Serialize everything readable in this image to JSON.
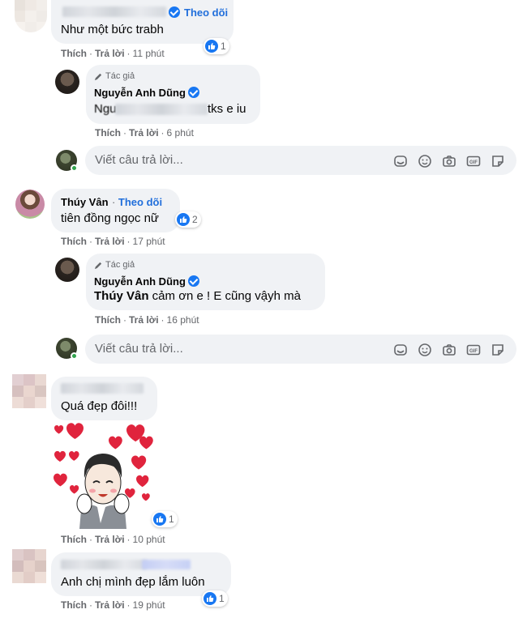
{
  "comments": [
    {
      "follow_label": "Theo dõi",
      "text": "Như một bức trabh",
      "reactions": "1",
      "like_label": "Thích",
      "reply_label": "Trả lời",
      "time": "11 phút",
      "reply": {
        "author_tag": "Tác giả",
        "name": "Nguyễn Anh Dũng",
        "text_prefix": "Ngu",
        "text_suffix": "tks e iu",
        "like_label": "Thích",
        "reply_label": "Trả lời",
        "time": "6 phút"
      }
    },
    {
      "name": "Thúy Vân",
      "follow_label": "Theo dõi",
      "text": "tiên đồng ngọc nữ",
      "reactions": "2",
      "like_label": "Thích",
      "reply_label": "Trả lời",
      "time": "17 phút",
      "reply": {
        "author_tag": "Tác giả",
        "name": "Nguyễn Anh Dũng",
        "mention": "Thúy Vân",
        "text": " cảm ơn e ! E cũng vậyh mà",
        "like_label": "Thích",
        "reply_label": "Trả lời",
        "time": "16 phút"
      }
    },
    {
      "text": "Quá đẹp đôi!!!",
      "reactions": "1",
      "like_label": "Thích",
      "reply_label": "Trả lời",
      "time": "10 phút"
    },
    {
      "text": "Anh chị mình đẹp lắm luôn",
      "reactions": "1",
      "like_label": "Thích",
      "reply_label": "Trả lời",
      "time": "19 phút"
    }
  ],
  "reply_box": {
    "placeholder": "Viết câu trả lời..."
  },
  "icons": [
    "like-icon",
    "pencil-icon",
    "verified-icon",
    "sticker-icon",
    "emoji-icon",
    "camera-icon",
    "gif-icon",
    "sticker-sheet-icon"
  ],
  "colors": {
    "bubble": "#f0f2f5",
    "link": "#216fdb",
    "like_blue": "#1877f2",
    "secondary_text": "#65676b",
    "online": "#31a24c",
    "heart": "#e0243d"
  }
}
